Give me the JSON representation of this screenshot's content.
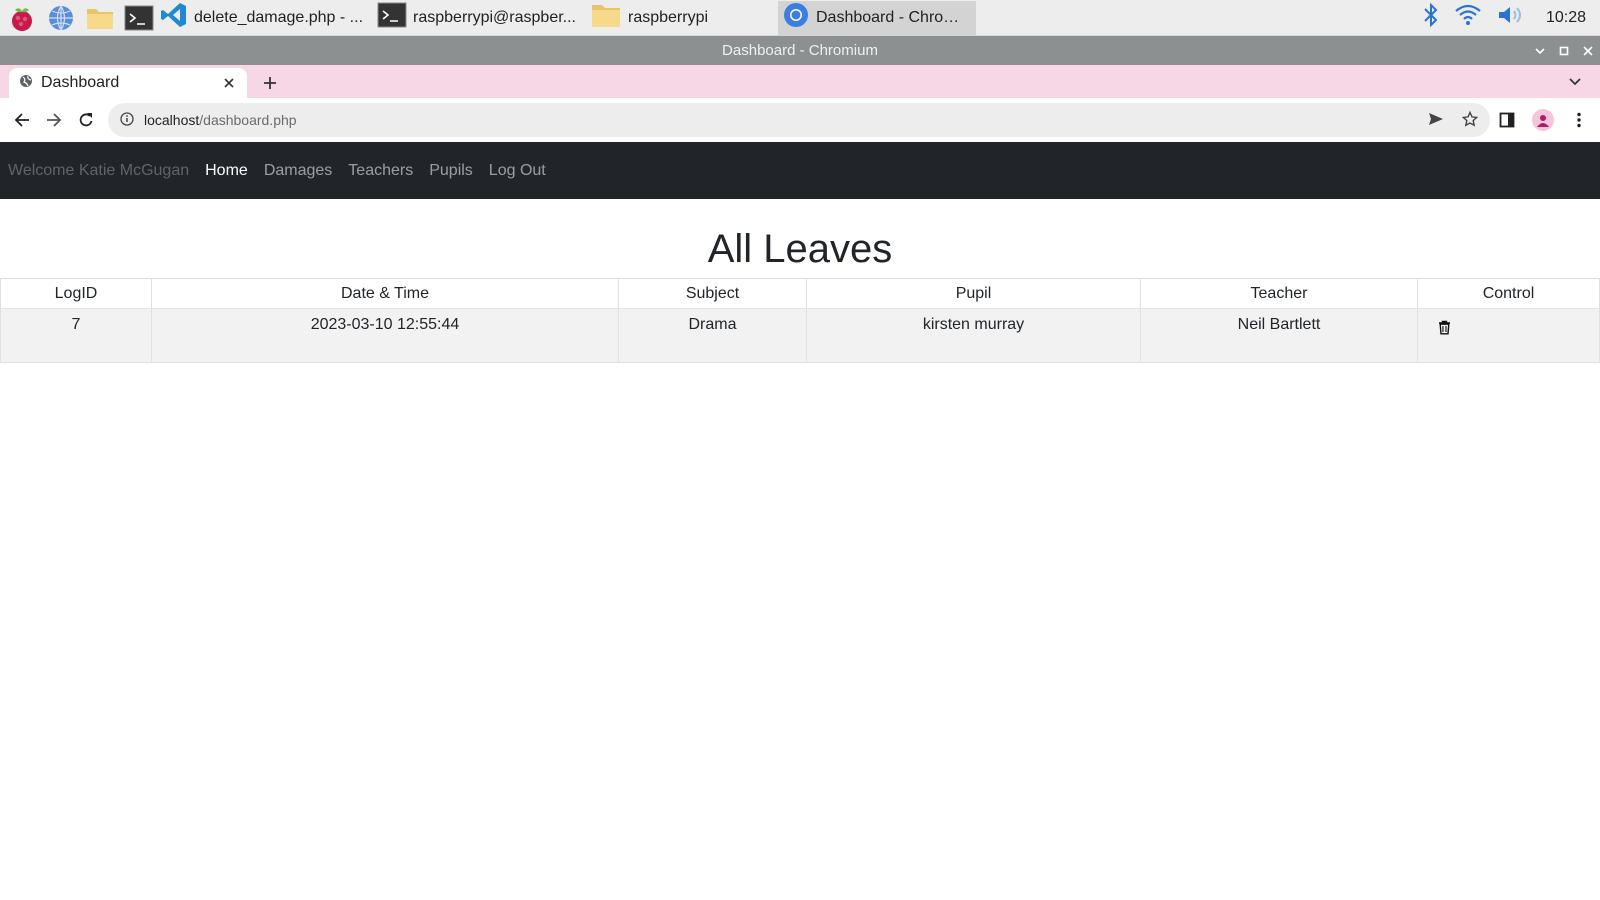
{
  "taskbar": {
    "tasks": [
      {
        "label": "delete_damage.php - ...",
        "icon": "vscode-icon"
      },
      {
        "label": "raspberrypi@raspber...",
        "icon": "terminal-icon"
      },
      {
        "label": "raspberrypi",
        "icon": "folder-icon"
      },
      {
        "label": "Dashboard - Chromiu...",
        "icon": "chromium-icon",
        "active": true
      }
    ],
    "clock": "10:28"
  },
  "window": {
    "title": "Dashboard - Chromium"
  },
  "browser": {
    "tab_title": "Dashboard",
    "url_host": "localhost",
    "url_path": "/dashboard.php"
  },
  "site": {
    "nav": {
      "welcome": "Welcome Katie McGugan",
      "links": [
        "Home",
        "Damages",
        "Teachers",
        "Pupils",
        "Log Out"
      ],
      "active": "Home"
    },
    "heading": "All Leaves",
    "table": {
      "columns": [
        "LogID",
        "Date & Time",
        "Subject",
        "Pupil",
        "Teacher",
        "Control"
      ],
      "rows": [
        {
          "logid": "7",
          "datetime": "2023-03-10 12:55:44",
          "subject": "Drama",
          "pupil": "kirsten murray",
          "teacher": "Neil Bartlett"
        }
      ]
    }
  },
  "colors": {
    "navbar_bg": "#212529",
    "tabstrip_bg": "#f7d7e6",
    "titlebar_bg": "#8d9091",
    "row_bg": "#f2f2f2"
  }
}
